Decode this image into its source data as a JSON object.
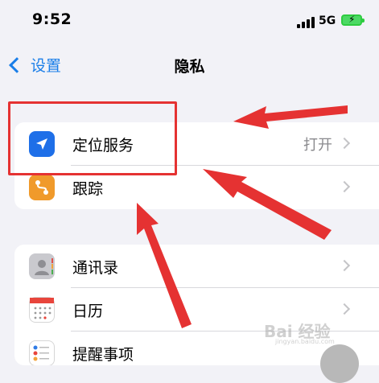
{
  "status_bar": {
    "time": "9:52",
    "network": "5G"
  },
  "nav": {
    "back_label": "设置",
    "title": "隐私"
  },
  "group1": [
    {
      "label": "定位服务",
      "value": "打开",
      "icon": "location-arrow-icon",
      "icon_color": "#1e6fe8"
    },
    {
      "label": "跟踪",
      "icon": "tracking-icon",
      "icon_color": "#f09a2b"
    }
  ],
  "group2": [
    {
      "label": "通讯录",
      "icon": "contacts-icon"
    },
    {
      "label": "日历",
      "icon": "calendar-icon"
    },
    {
      "label": "提醒事项",
      "icon": "reminders-icon"
    }
  ],
  "annotation": {
    "highlight_color": "#e53232"
  },
  "watermark": {
    "text": "Bai 经验",
    "subtext": "jingyan.baidu.com"
  }
}
